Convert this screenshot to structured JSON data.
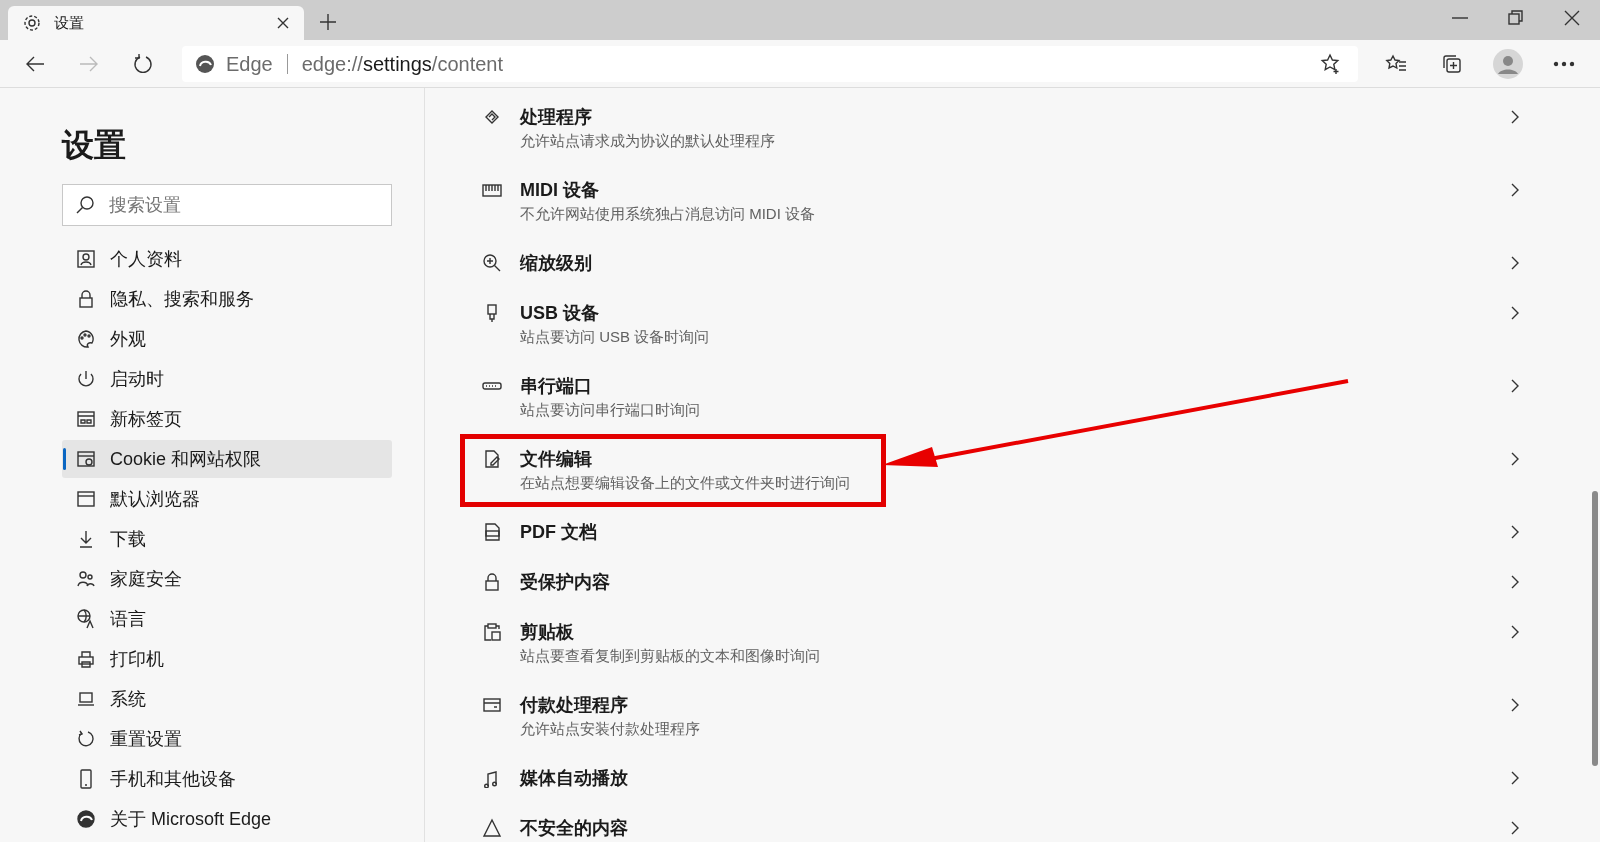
{
  "browser_tab": {
    "title": "设置",
    "selected": true
  },
  "address_bar": {
    "site_label": "Edge",
    "url_prefix": "edge://",
    "url_main": "settings",
    "url_suffix": "/content"
  },
  "sidebar": {
    "title": "设置",
    "search": {
      "placeholder": "搜索设置"
    },
    "items": [
      {
        "label": "个人资料",
        "selected": false
      },
      {
        "label": "隐私、搜索和服务",
        "selected": false
      },
      {
        "label": "外观",
        "selected": false
      },
      {
        "label": "启动时",
        "selected": false
      },
      {
        "label": "新标签页",
        "selected": false
      },
      {
        "label": "Cookie 和网站权限",
        "selected": true
      },
      {
        "label": "默认浏览器",
        "selected": false
      },
      {
        "label": "下载",
        "selected": false
      },
      {
        "label": "家庭安全",
        "selected": false
      },
      {
        "label": "语言",
        "selected": false
      },
      {
        "label": "打印机",
        "selected": false
      },
      {
        "label": "系统",
        "selected": false
      },
      {
        "label": "重置设置",
        "selected": false
      },
      {
        "label": "手机和其他设备",
        "selected": false
      },
      {
        "label": "关于 Microsoft Edge",
        "selected": false
      }
    ]
  },
  "permissions": [
    {
      "title": "处理程序",
      "description": "允许站点请求成为协议的默认处理程序",
      "highlighted": false
    },
    {
      "title": "MIDI 设备",
      "description": "不允许网站使用系统独占消息访问 MIDI 设备",
      "highlighted": false
    },
    {
      "title": "缩放级别",
      "highlighted": false
    },
    {
      "title": "USB 设备",
      "description": "站点要访问 USB 设备时询问",
      "highlighted": false
    },
    {
      "title": "串行端口",
      "description": "站点要访问串行端口时询问",
      "highlighted": false
    },
    {
      "title": "文件编辑",
      "description": "在站点想要编辑设备上的文件或文件夹时进行询问",
      "highlighted": true
    },
    {
      "title": "PDF 文档",
      "highlighted": false
    },
    {
      "title": "受保护内容",
      "highlighted": false
    },
    {
      "title": "剪贴板",
      "description": "站点要查看复制到剪贴板的文本和图像时询问",
      "highlighted": false
    },
    {
      "title": "付款处理程序",
      "description": "允许站点安装付款处理程序",
      "highlighted": false
    },
    {
      "title": "媒体自动播放",
      "highlighted": false
    },
    {
      "title": "不安全的内容",
      "highlighted": false
    }
  ]
}
